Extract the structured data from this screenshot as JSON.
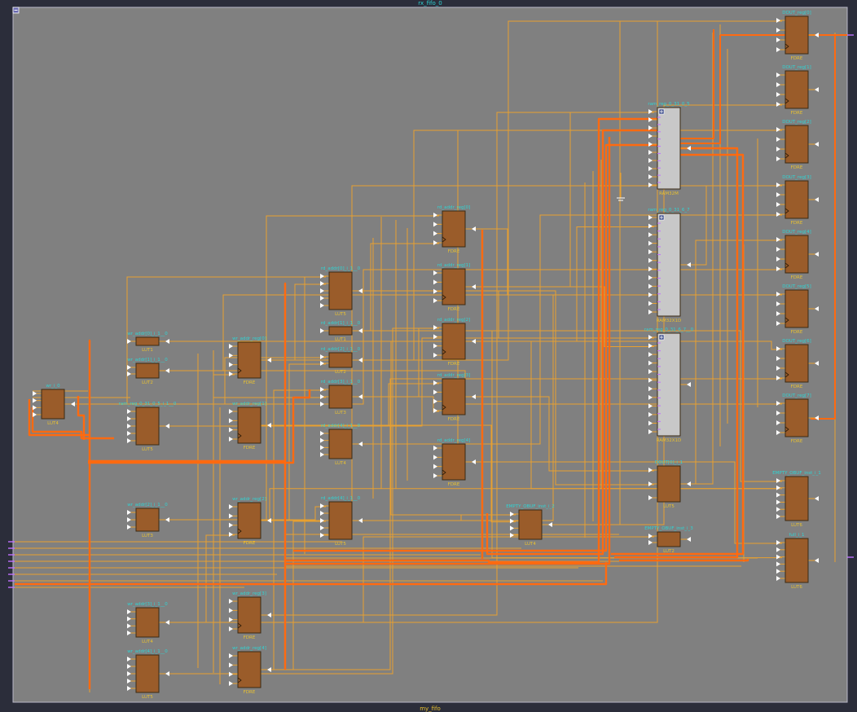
{
  "module": {
    "instance_name": "rx_fifo_0",
    "footer_name": "my_fifo",
    "collapse_icon": "minus-box-icon"
  },
  "colors": {
    "background": "#2b2d3a",
    "canvas": "#808080",
    "cell_fill": "#9a5c2a",
    "cell_border": "#3a2a14",
    "ram_fill": "#c8c8c8",
    "instance_label": "#2fd3d3",
    "type_label": "#e8c030",
    "wire": "#e8a030",
    "bus": "#ff6a10",
    "port_stub": "#c070ff"
  },
  "cells": [
    {
      "id": "mx0",
      "name": "wr_i_0",
      "type": "LUT4"
    },
    {
      "id": "wa0",
      "name": "wr_addr[0]_i_1__0",
      "type": "LUT1"
    },
    {
      "id": "wa1",
      "name": "wr_addr[1]_i_1__0",
      "type": "LUT2"
    },
    {
      "id": "ram0",
      "name": "ram_reg_0_31_0_5_i_1__0",
      "type": "LUT5"
    },
    {
      "id": "wa2",
      "name": "wr_addr[2]_i_1__0",
      "type": "LUT3"
    },
    {
      "id": "wa3",
      "name": "wr_addr[3]_i_1__0",
      "type": "LUT4"
    },
    {
      "id": "wa4",
      "name": "wr_addr[4]_i_1__0",
      "type": "LUT5"
    },
    {
      "id": "wr0",
      "name": "wr_addr_reg[0]",
      "type": "FDRE"
    },
    {
      "id": "wr1",
      "name": "wr_addr_reg[1]",
      "type": "FDRE"
    },
    {
      "id": "wr2",
      "name": "wr_addr_reg[2]",
      "type": "FDRE"
    },
    {
      "id": "wr3",
      "name": "wr_addr_reg[3]",
      "type": "FDRE"
    },
    {
      "id": "wr4",
      "name": "wr_addr_reg[4]",
      "type": "FDRE"
    },
    {
      "id": "ra0",
      "name": "rd_addr[0]_i_1__0",
      "type": "LUT5"
    },
    {
      "id": "ra1",
      "name": "rd_addr[1]_i_1__0",
      "type": "LUT1"
    },
    {
      "id": "ra2",
      "name": "rd_addr[2]_i_1__0",
      "type": "LUT2"
    },
    {
      "id": "ra3",
      "name": "rd_addr[3]_i_1__0",
      "type": "LUT3"
    },
    {
      "id": "ra4",
      "name": "rd_addr[4]_i_1__0",
      "type": "LUT4"
    },
    {
      "id": "ra5",
      "name": "rd_addr[4]_i_1__0",
      "type": "LUT5"
    },
    {
      "id": "rr0",
      "name": "rd_addr_reg[0]",
      "type": "FDRE"
    },
    {
      "id": "rr1",
      "name": "rd_addr_reg[1]",
      "type": "FDRE"
    },
    {
      "id": "rr2",
      "name": "rd_addr_reg[2]",
      "type": "FDRE"
    },
    {
      "id": "rr3",
      "name": "rd_addr_reg[3]",
      "type": "FDRE"
    },
    {
      "id": "rr4",
      "name": "rd_addr_reg[4]",
      "type": "FDRE"
    },
    {
      "id": "em0",
      "name": "EMPTY_OBUF_inst_i_2",
      "type": "LUT4"
    },
    {
      "id": "ram1",
      "name": "ram_reg_0_31_0_5",
      "type": "RAM32M"
    },
    {
      "id": "ram2",
      "name": "ram_reg_0_31_6_7",
      "type": "RAM32X1D"
    },
    {
      "id": "ram3",
      "name": "ram_reg_0_31_6_7__0",
      "type": "RAM32X1D"
    },
    {
      "id": "d0",
      "name": "DOUT[0]_i_1",
      "type": "LUT5"
    },
    {
      "id": "em1",
      "name": "EMPTY_OBUF_inst_i_3",
      "type": "LUT2"
    },
    {
      "id": "do0",
      "name": "DOUT_reg[0]",
      "type": "FDRE"
    },
    {
      "id": "do1",
      "name": "DOUT_reg[1]",
      "type": "FDRE"
    },
    {
      "id": "do2",
      "name": "DOUT_reg[2]",
      "type": "FDRE"
    },
    {
      "id": "do3",
      "name": "DOUT_reg[3]",
      "type": "FDRE"
    },
    {
      "id": "do4",
      "name": "DOUT_reg[4]",
      "type": "FDRE"
    },
    {
      "id": "do5",
      "name": "DOUT_reg[5]",
      "type": "FDRE"
    },
    {
      "id": "do6",
      "name": "DOUT_reg[6]",
      "type": "FDRE"
    },
    {
      "id": "do7",
      "name": "DOUT_reg[7]",
      "type": "FDRE"
    },
    {
      "id": "ef",
      "name": "EMPTY_OBUF_inst_i_1",
      "type": "LUT6"
    },
    {
      "id": "fl",
      "name": "full_i_1",
      "type": "LUT6"
    }
  ]
}
